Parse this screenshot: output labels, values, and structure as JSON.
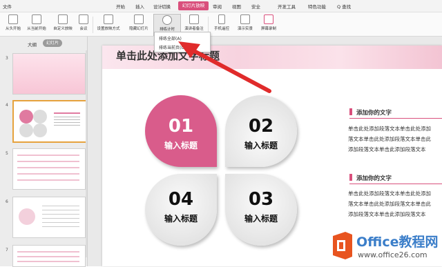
{
  "menubar": {
    "items": [
      "文件",
      "开始",
      "插入",
      "设计",
      "切换",
      "动画",
      "审阅",
      "视图",
      "安全",
      "开发工具",
      "特色功能",
      "Q 查找"
    ],
    "active_tab": "幻灯片放映"
  },
  "ribbon": {
    "tools": [
      "从头开始",
      "从当前开始",
      "自定义放映",
      "会议",
      "设置放映方式",
      "隐藏幻灯片",
      "排练计时",
      "演讲者备注",
      "手机遥控",
      "演示实景",
      "屏幕录制"
    ]
  },
  "dropdown": {
    "items": [
      "排练全部(A)",
      "排练当前页(C)"
    ]
  },
  "left_panel": {
    "tabs": [
      "大纲",
      "幻灯片"
    ],
    "slide_numbers": [
      "3",
      "4",
      "5",
      "6",
      "7"
    ]
  },
  "slide": {
    "title": "单击此处添加文字标题",
    "petals": [
      {
        "num": "01",
        "label": "输入标题"
      },
      {
        "num": "02",
        "label": "输入标题"
      },
      {
        "num": "04",
        "label": "输入标题"
      },
      {
        "num": "03",
        "label": "输入标题"
      }
    ],
    "sections": [
      {
        "title": "添加你的文字",
        "lines": [
          "单击此处添加段落文本单击此处添加",
          "落文本单击此处添加段落文本单击此",
          "添加段落文本单击此添加段落文本"
        ]
      },
      {
        "title": "添加你的文字",
        "lines": [
          "单击此处添加段落文本单击此处添加",
          "落文本单击此处添加段落文本单击此",
          "添加段落文本单击此添加段落文本"
        ]
      }
    ]
  },
  "watermark": {
    "brand": "Office教程网",
    "url": "www.office26.com"
  },
  "colors": {
    "accent": "#d94f7c",
    "arrow": "#e02b2b"
  }
}
